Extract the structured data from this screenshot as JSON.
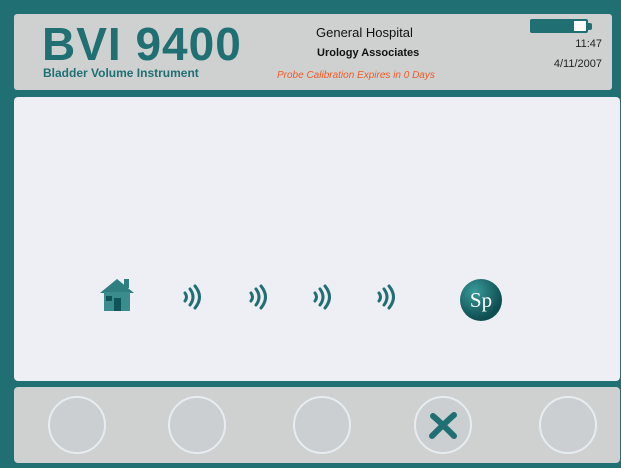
{
  "app": {
    "title": "BVI 9400",
    "subtitle": "Bladder Volume Instrument"
  },
  "header": {
    "hospital": "General Hospital",
    "clinic": "Urology Associates",
    "calibration_notice": "Probe Calibration Expires in 0 Days",
    "battery_level_fraction": 0.78,
    "time": "11:47",
    "date": "4/11/2007"
  },
  "main": {
    "status_icons": [
      "home-icon",
      "wireless-signal-icon",
      "wireless-signal-icon",
      "wireless-signal-icon",
      "wireless-signal-icon",
      "sp-logo-icon"
    ],
    "sp_logo_text": "Sp"
  },
  "footer": {
    "buttons": [
      {
        "name": "soft-button-1",
        "icon": "none"
      },
      {
        "name": "soft-button-2",
        "icon": "none"
      },
      {
        "name": "soft-button-3",
        "icon": "none"
      },
      {
        "name": "cancel-button",
        "icon": "x-icon"
      },
      {
        "name": "soft-button-5",
        "icon": "none"
      }
    ]
  },
  "colors": {
    "frame": "#1f6f73",
    "panel": "#cfd1d1",
    "main_bg": "#eeeff4",
    "warning": "#f05a28"
  }
}
